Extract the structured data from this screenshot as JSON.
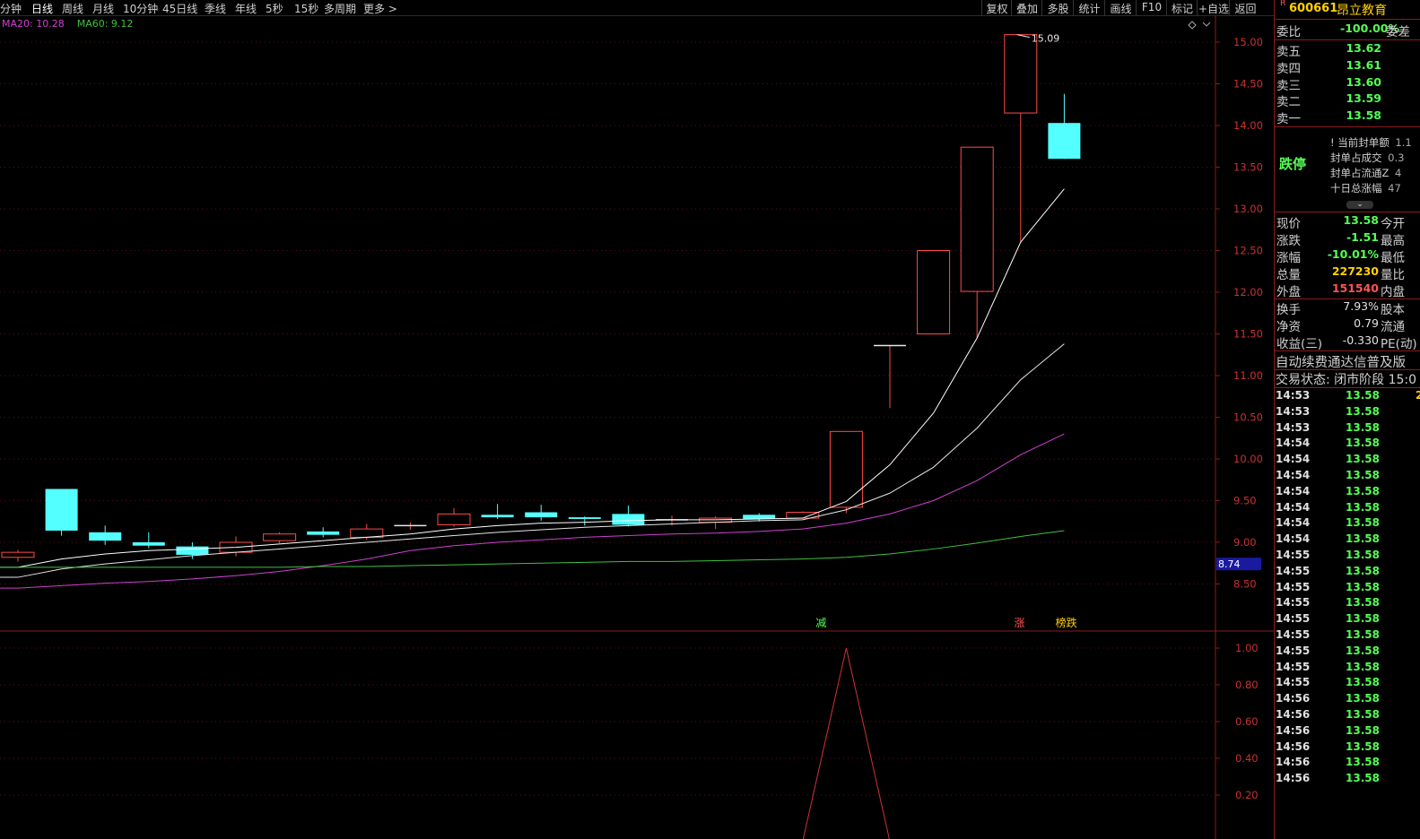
{
  "toolbar": {
    "periods": [
      "分钟",
      "日线",
      "周线",
      "月线",
      "10分钟",
      "45日线",
      "季线",
      "年线",
      "5秒",
      "15秒",
      "多周期",
      "更多 >"
    ],
    "active_period": "日线",
    "right_tools": [
      "复权",
      "叠加",
      "多股",
      "统计",
      "画线",
      "F10",
      "标记",
      "+自选",
      "返回"
    ]
  },
  "ma_legend": {
    "ma20": "MA20: 10.28",
    "ma60": "MA60: 9.12",
    "ma20_color": "#d040d0",
    "ma60_color": "#40c040"
  },
  "chart_data": {
    "type": "candlestick",
    "y_axis_labels": [
      "15.00",
      "14.50",
      "14.00",
      "13.50",
      "13.00",
      "12.50",
      "12.00",
      "11.50",
      "11.00",
      "10.50",
      "10.00",
      "9.50",
      "9.00",
      "8.50"
    ],
    "ylim": [
      8.2,
      15.5
    ],
    "candles": [
      {
        "o": 8.82,
        "c": 8.88,
        "h": 8.91,
        "l": 8.77
      },
      {
        "o": 9.64,
        "c": 9.14,
        "h": 9.64,
        "l": 9.08
      },
      {
        "o": 9.12,
        "c": 9.02,
        "h": 9.2,
        "l": 8.97
      },
      {
        "o": 9.0,
        "c": 8.96,
        "h": 9.12,
        "l": 8.93
      },
      {
        "o": 8.95,
        "c": 8.85,
        "h": 9.0,
        "l": 8.8
      },
      {
        "o": 8.88,
        "c": 9.0,
        "h": 9.07,
        "l": 8.83
      },
      {
        "o": 9.02,
        "c": 9.1,
        "h": 9.12,
        "l": 8.99
      },
      {
        "o": 9.13,
        "c": 9.09,
        "h": 9.18,
        "l": 9.06
      },
      {
        "o": 9.06,
        "c": 9.16,
        "h": 9.22,
        "l": 9.03
      },
      {
        "o": 9.2,
        "c": 9.2,
        "h": 9.24,
        "l": 9.15
      },
      {
        "o": 9.21,
        "c": 9.34,
        "h": 9.41,
        "l": 9.19
      },
      {
        "o": 9.33,
        "c": 9.3,
        "h": 9.46,
        "l": 9.28
      },
      {
        "o": 9.36,
        "c": 9.3,
        "h": 9.45,
        "l": 9.26
      },
      {
        "o": 9.3,
        "c": 9.28,
        "h": 9.31,
        "l": 9.2
      },
      {
        "o": 9.34,
        "c": 9.21,
        "h": 9.44,
        "l": 9.19
      },
      {
        "o": 9.27,
        "c": 9.27,
        "h": 9.32,
        "l": 9.2
      },
      {
        "o": 9.24,
        "c": 9.29,
        "h": 9.31,
        "l": 9.16
      },
      {
        "o": 9.33,
        "c": 9.28,
        "h": 9.35,
        "l": 9.25
      },
      {
        "o": 9.29,
        "c": 9.36,
        "h": 9.37,
        "l": 9.28
      },
      {
        "o": 9.42,
        "c": 10.33,
        "h": 10.33,
        "l": 9.35
      },
      {
        "o": 11.36,
        "c": 11.36,
        "h": 11.36,
        "l": 10.61
      },
      {
        "o": 11.5,
        "c": 12.5,
        "h": 12.5,
        "l": 11.5
      },
      {
        "o": 12.01,
        "c": 13.74,
        "h": 13.74,
        "l": 11.45
      },
      {
        "o": 14.15,
        "c": 15.09,
        "h": 15.09,
        "l": 12.6
      },
      {
        "o": 14.03,
        "c": 13.6,
        "h": 14.38,
        "l": 13.6
      }
    ],
    "high_label": "15.09",
    "current_price_tag": "8.74",
    "signals": [
      {
        "text": "减",
        "color": "#54ff54"
      },
      {
        "text": "涨",
        "color": "#ff5454"
      },
      {
        "text": "榜跌",
        "color": "#ffd200"
      }
    ],
    "sub_axis_labels": [
      "1.00",
      "0.80",
      "0.60",
      "0.40",
      "0.20"
    ],
    "sub_ylim": [
      0,
      1.0
    ],
    "ma_lines": {
      "ma5": [
        8.7,
        8.8,
        8.86,
        8.9,
        8.92,
        8.94,
        8.98,
        9.02,
        9.06,
        9.1,
        9.16,
        9.2,
        9.23,
        9.24,
        9.26,
        9.27,
        9.27,
        9.28,
        9.29,
        9.49,
        9.93,
        10.55,
        11.45,
        12.6,
        13.24
      ],
      "ma10": [
        8.58,
        8.68,
        8.74,
        8.79,
        8.84,
        8.88,
        8.92,
        8.96,
        9.0,
        9.04,
        9.08,
        9.12,
        9.15,
        9.18,
        9.2,
        9.22,
        9.24,
        9.26,
        9.27,
        9.39,
        9.59,
        9.9,
        10.37,
        10.95,
        11.38
      ],
      "ma20": [
        8.45,
        8.48,
        8.51,
        8.53,
        8.56,
        8.6,
        8.65,
        8.72,
        8.8,
        8.9,
        8.96,
        9.0,
        9.03,
        9.06,
        9.08,
        9.1,
        9.11,
        9.13,
        9.16,
        9.23,
        9.34,
        9.5,
        9.74,
        10.05,
        10.3
      ],
      "ma60": [
        8.7,
        8.7,
        8.7,
        8.7,
        8.7,
        8.7,
        8.7,
        8.71,
        8.71,
        8.72,
        8.73,
        8.74,
        8.75,
        8.76,
        8.77,
        8.77,
        8.78,
        8.79,
        8.8,
        8.82,
        8.86,
        8.92,
        8.99,
        9.07,
        9.14
      ]
    }
  },
  "quote_panel": {
    "code": "600661",
    "name": "昂立教育",
    "flag": "R",
    "weibi_label": "委比",
    "weibi_value": "-100.00%",
    "weicha_label": "委差",
    "asks": [
      {
        "label": "卖五",
        "price": "13.62"
      },
      {
        "label": "卖四",
        "price": "13.61"
      },
      {
        "label": "卖三",
        "price": "13.60"
      },
      {
        "label": "卖二",
        "price": "13.59"
      },
      {
        "label": "卖一",
        "price": "13.58"
      }
    ],
    "limit_status": "跌停",
    "seal_info": [
      {
        "label": "! 当前封单额",
        "value": "1.1"
      },
      {
        "label": "封单占成交",
        "value": "0.3"
      },
      {
        "label": "封单占流通Z",
        "value": "4"
      },
      {
        "label": "十日总涨幅",
        "value": "47"
      }
    ],
    "stats": [
      {
        "l": "现价",
        "v": "13.58",
        "r": "今开",
        "color": "#54ff54"
      },
      {
        "l": "涨跌",
        "v": "-1.51",
        "r": "最高",
        "color": "#54ff54"
      },
      {
        "l": "涨幅",
        "v": "-10.01%",
        "r": "最低",
        "color": "#54ff54"
      },
      {
        "l": "总量",
        "v": "227230",
        "r": "量比",
        "color": "#ffd200"
      },
      {
        "l": "外盘",
        "v": "151540",
        "r": "内盘",
        "color": "#ff5454"
      }
    ],
    "stats2": [
      {
        "l": "换手",
        "v": "7.93%",
        "r": "股本",
        "color": "#e0e0e0"
      },
      {
        "l": "净资",
        "v": "0.79",
        "r": "流通",
        "color": "#e0e0e0"
      },
      {
        "l": "收益(三)",
        "v": "-0.330",
        "r": "PE(动)",
        "color": "#e0e0e0"
      }
    ],
    "notice": "自动续费通达信普及版",
    "trade_status": "交易状态: 闭市阶段 15:0",
    "ticks": [
      {
        "t": "14:53",
        "p": "13.58",
        "v": "2"
      },
      {
        "t": "14:53",
        "p": "13.58"
      },
      {
        "t": "14:53",
        "p": "13.58"
      },
      {
        "t": "14:54",
        "p": "13.58"
      },
      {
        "t": "14:54",
        "p": "13.58"
      },
      {
        "t": "14:54",
        "p": "13.58"
      },
      {
        "t": "14:54",
        "p": "13.58"
      },
      {
        "t": "14:54",
        "p": "13.58"
      },
      {
        "t": "14:54",
        "p": "13.58"
      },
      {
        "t": "14:54",
        "p": "13.58"
      },
      {
        "t": "14:55",
        "p": "13.58"
      },
      {
        "t": "14:55",
        "p": "13.58"
      },
      {
        "t": "14:55",
        "p": "13.58"
      },
      {
        "t": "14:55",
        "p": "13.58"
      },
      {
        "t": "14:55",
        "p": "13.58"
      },
      {
        "t": "14:55",
        "p": "13.58"
      },
      {
        "t": "14:55",
        "p": "13.58"
      },
      {
        "t": "14:55",
        "p": "13.58"
      },
      {
        "t": "14:55",
        "p": "13.58"
      },
      {
        "t": "14:56",
        "p": "13.58"
      },
      {
        "t": "14:56",
        "p": "13.58"
      },
      {
        "t": "14:56",
        "p": "13.58"
      },
      {
        "t": "14:56",
        "p": "13.58"
      },
      {
        "t": "14:56",
        "p": "13.58"
      },
      {
        "t": "14:56",
        "p": "13.58"
      }
    ]
  }
}
